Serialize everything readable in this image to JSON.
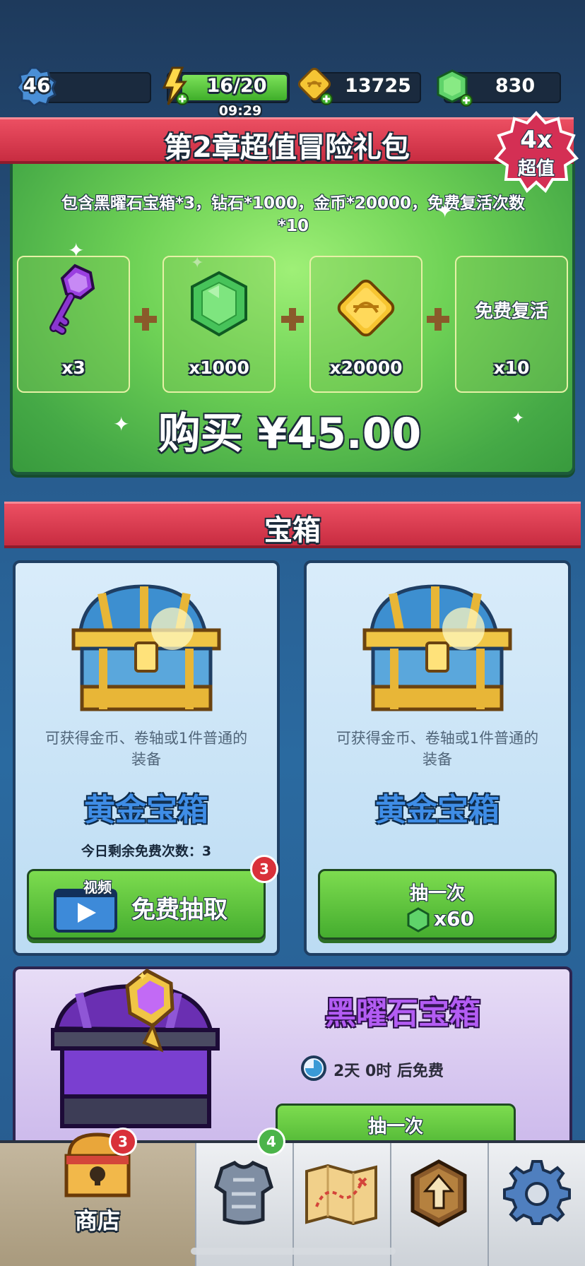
{
  "topbar": {
    "level": "46",
    "energy": "16/20",
    "energy_timer": "09:29",
    "gold": "13725",
    "gems": "830"
  },
  "package": {
    "title": "第2章超值冒险礼包",
    "badge_multiplier": "4x",
    "badge_label": "超值",
    "description": "包含黑曜石宝箱*3，钻石*1000，金币*20000，免费复活次数*10",
    "items": [
      {
        "icon": "purple-key-icon",
        "qty": "x3"
      },
      {
        "icon": "gem-icon",
        "qty": "x1000"
      },
      {
        "icon": "gold-coin-icon",
        "qty": "x20000"
      },
      {
        "icon": "revive-text",
        "label": "免费复活",
        "qty": "x10"
      }
    ],
    "buy_label": "购买 ¥45.00"
  },
  "chests": {
    "section_title": "宝箱",
    "left": {
      "desc": "可获得金币、卷轴或1件普通的装备",
      "name": "黄金宝箱",
      "free_count": "今日剩余免费次数：3",
      "video_tag": "视频",
      "button_label": "免费抽取",
      "badge": "3"
    },
    "right": {
      "desc": "可获得金币、卷轴或1件普通的装备",
      "name": "黄金宝箱",
      "button_label": "抽一次",
      "cost": "x60"
    },
    "obsidian": {
      "name": "黑曜石宝箱",
      "timer": "2天 0时 后免费",
      "button_label": "抽一次"
    }
  },
  "nav": {
    "shop_label": "商店",
    "shop_badge": "3",
    "equipment_badge": "4"
  },
  "colors": {
    "ribbon_red": "#d83a4e",
    "panel_green": "#6fd256",
    "button_green": "#5cc23c",
    "gold_chest_blue": "#3f8de6",
    "obsidian_purple": "#b35cf3"
  }
}
